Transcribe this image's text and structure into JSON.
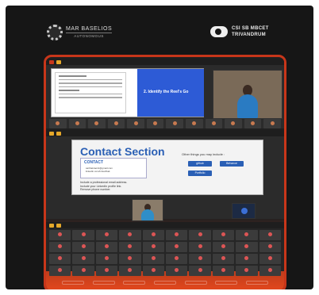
{
  "brand_left": {
    "name": "MAR BASELIOS",
    "sub": "AUTONOMOUS"
  },
  "brand_right": {
    "line1": "CSI SB MBCET",
    "line2": "TRIVANDRUM"
  },
  "slide1": {
    "heading": "2. Identify the Reel's Go"
  },
  "slide2": {
    "title": "Contact Section",
    "contact_label": "CONTACT",
    "contact_lines": [
      "sarthakrao11@gmail.com",
      "linkedin.com/in/sarthak"
    ],
    "bullets": [
      "Include a professional email address.",
      "Include your LinkedIn profile link.",
      "Remove phone number."
    ],
    "other_label": "Other things you may include :",
    "pills": [
      "github",
      "Behance",
      "Portfolio"
    ]
  },
  "colors": {
    "accent": "#c8361a",
    "blue": "#2a5fb5",
    "bg": "#161616"
  }
}
